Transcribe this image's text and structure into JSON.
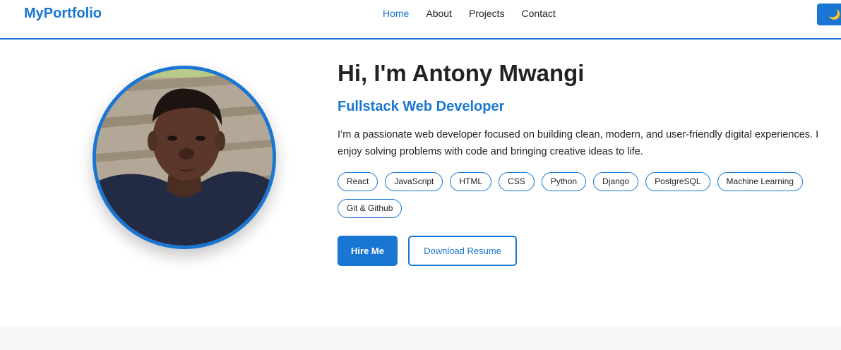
{
  "brand": "MyPortfolio",
  "nav": {
    "links": [
      {
        "label": "Home",
        "active": true
      },
      {
        "label": "About",
        "active": false
      },
      {
        "label": "Projects",
        "active": false
      },
      {
        "label": "Contact",
        "active": false
      }
    ],
    "theme_toggle_icon": "moon-icon",
    "theme_toggle_glyph": "🌙"
  },
  "hero": {
    "title": "Hi, I'm Antony Mwangi",
    "subtitle": "Fullstack Web Developer",
    "bio": "I’m a passionate web developer focused on building clean, modern, and user-friendly digital experiences. I enjoy solving problems with code and bringing creative ideas to life.",
    "skills": [
      "React",
      "JavaScript",
      "HTML",
      "CSS",
      "Python",
      "Django",
      "PostgreSQL",
      "Machine Learning",
      "Git & Github"
    ],
    "hire_label": "Hire Me",
    "resume_label": "Download Resume"
  },
  "colors": {
    "accent": "#1976d2",
    "text": "#222222",
    "section_bg": "#f7f7f7"
  }
}
